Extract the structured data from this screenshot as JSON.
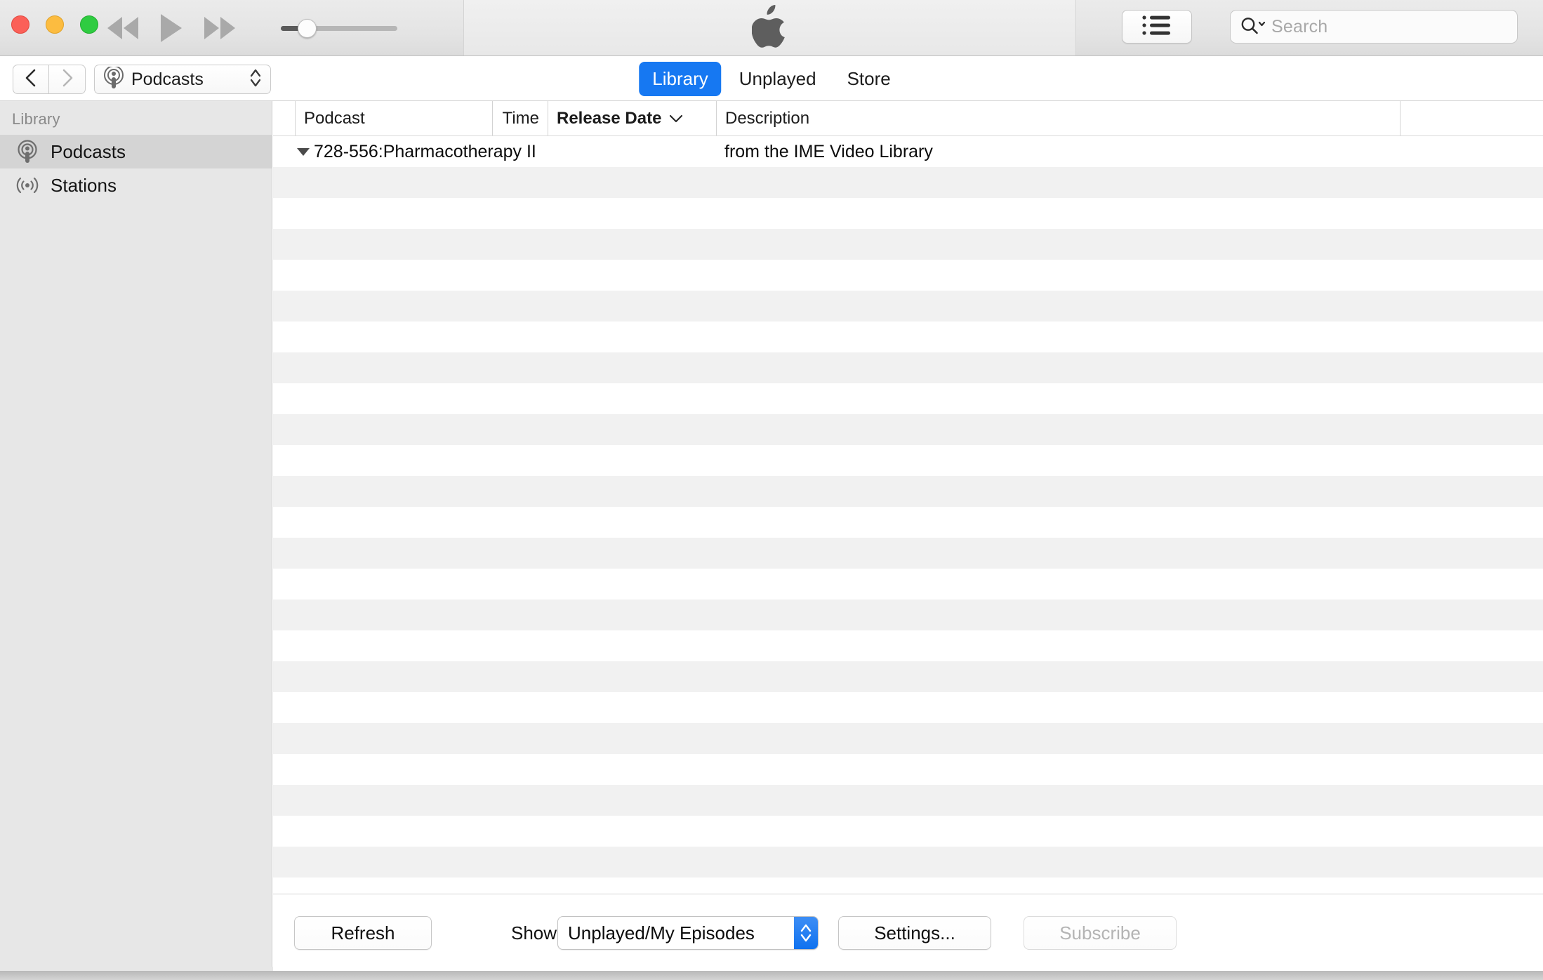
{
  "window": {
    "traffic_lights": [
      "close",
      "minimize",
      "maximize"
    ],
    "apple_logo": "apple-logo"
  },
  "transport": {
    "rewind_label": "Rewind",
    "play_label": "Play",
    "fastforward_label": "Fast Forward",
    "volume_value": 22,
    "volume_min": 0,
    "volume_max": 100
  },
  "toolbar": {
    "list_view_label": "List View",
    "search": {
      "placeholder": "Search",
      "value": "",
      "icon": "search-icon"
    }
  },
  "navbar": {
    "back_label": "Back",
    "forward_label": "Forward",
    "source_popup": {
      "label": "Podcasts",
      "icon": "podcast-icon"
    },
    "tabs": [
      {
        "label": "Library",
        "active": true
      },
      {
        "label": "Unplayed",
        "active": false
      },
      {
        "label": "Store",
        "active": false
      }
    ]
  },
  "sidebar": {
    "header": "Library",
    "items": [
      {
        "label": "Podcasts",
        "icon": "podcast-icon",
        "selected": true
      },
      {
        "label": "Stations",
        "icon": "stations-icon",
        "selected": false
      }
    ]
  },
  "table": {
    "columns": [
      {
        "key": "podcast",
        "label": "Podcast",
        "sorted": false,
        "align": "left"
      },
      {
        "key": "time",
        "label": "Time",
        "sorted": false,
        "align": "right"
      },
      {
        "key": "release_date",
        "label": "Release Date",
        "sorted": true,
        "sort_direction": "descending",
        "align": "left"
      },
      {
        "key": "description",
        "label": "Description",
        "sorted": false,
        "align": "left"
      },
      {
        "key": "extra",
        "label": "",
        "sorted": false,
        "align": "left"
      }
    ],
    "rows": [
      {
        "disclosure": "expanded",
        "podcast": "728-556:Pharmacotherapy II",
        "time": "",
        "release_date": "",
        "description": "from the IME Video Library"
      }
    ],
    "empty_row_count": 24
  },
  "bottombar": {
    "refresh_label": "Refresh",
    "show_label": "Show:",
    "show_value": "Unplayed/My Episodes",
    "settings_label": "Settings...",
    "subscribe_label": "Subscribe",
    "subscribe_disabled": true
  },
  "colors": {
    "accent": "#1678f2",
    "selected_row": "#d4d4d4",
    "stripe": "#f1f1f1",
    "sidebar_bg": "#e7e7e7",
    "titlebar_bg": "#e4e4e4"
  }
}
